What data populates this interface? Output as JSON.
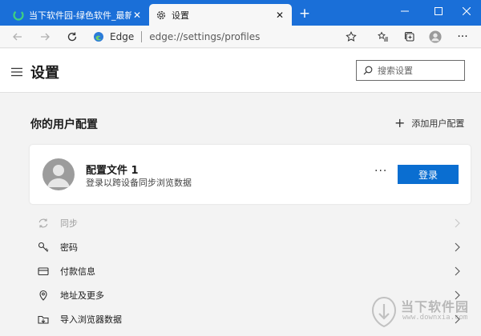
{
  "tabs": [
    {
      "title": "当下软件园-绿色软件_最新绿色",
      "close": "✕"
    },
    {
      "title": "设置",
      "close": "✕"
    }
  ],
  "new_tab": "+",
  "address": {
    "brand": "Edge",
    "url": "edge://settings/profiles"
  },
  "more_menu": "···",
  "header": {
    "title": "设置",
    "search_placeholder": "搜索设置"
  },
  "profiles": {
    "section_title": "你的用户配置",
    "add_label": "添加用户配置",
    "add_plus": "+",
    "card": {
      "name": "配置文件 1",
      "subtitle": "登录以跨设备同步浏览数据",
      "more": "···",
      "signin_label": "登录"
    }
  },
  "settings_items": [
    {
      "label": "同步",
      "icon": "sync-icon",
      "disabled": true
    },
    {
      "label": "密码",
      "icon": "key-icon",
      "disabled": false
    },
    {
      "label": "付款信息",
      "icon": "credit-card-icon",
      "disabled": false
    },
    {
      "label": "地址及更多",
      "icon": "location-pin-icon",
      "disabled": false
    },
    {
      "label": "导入浏览器数据",
      "icon": "import-icon",
      "disabled": false
    }
  ],
  "watermark": {
    "name": "当下软件园",
    "url": "www.downxia.com"
  },
  "colors": {
    "titlebar": "#1a6fd8",
    "accent": "#0a6ed1",
    "background": "#f3f3f3"
  }
}
